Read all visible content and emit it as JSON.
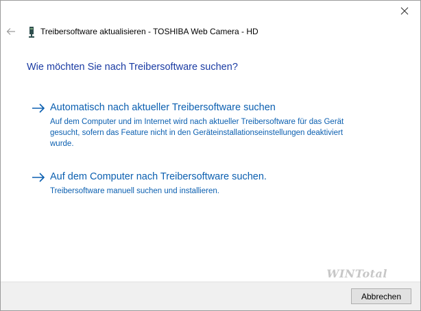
{
  "window": {
    "title": "Treibersoftware aktualisieren - TOSHIBA Web Camera - HD"
  },
  "main": {
    "heading": "Wie möchten Sie nach Treibersoftware suchen?",
    "options": [
      {
        "title": "Automatisch nach aktueller Treibersoftware suchen",
        "description": "Auf dem Computer und im Internet wird nach aktueller Treibersoftware für das Gerät gesucht, sofern das Feature nicht in den Geräteinstallationseinstellungen deaktiviert wurde."
      },
      {
        "title": "Auf dem Computer nach Treibersoftware suchen.",
        "description": "Treibersoftware manuell suchen und installieren."
      }
    ]
  },
  "footer": {
    "cancel_label": "Abbrechen",
    "watermark": "WINTotal"
  },
  "icons": {
    "close": "close-icon",
    "back": "back-arrow-icon",
    "device": "webcam-device-icon",
    "option": "arrow-right-icon"
  },
  "colors": {
    "heading": "#1a3ba3",
    "link": "#0b5fb0",
    "footer_bg": "#f0f0f0"
  }
}
